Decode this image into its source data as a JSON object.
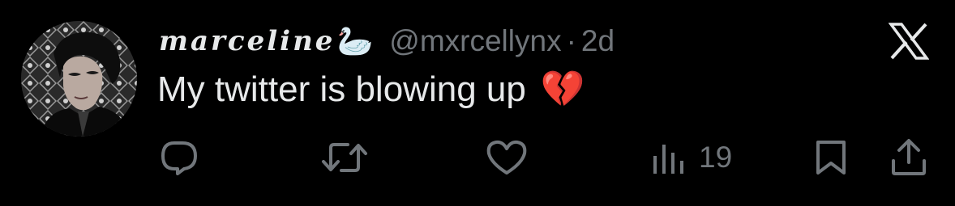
{
  "tweet": {
    "display_name": "marceline",
    "name_emoji": "🦢",
    "handle": "@mxrcellynx",
    "separator": "·",
    "time": "2d",
    "text": "My twitter is blowing up",
    "text_emoji": "💔"
  },
  "actions": {
    "reply_icon": "reply-icon",
    "retweet_icon": "retweet-icon",
    "like_icon": "like-icon",
    "views_icon": "views-icon",
    "views_count": "19",
    "bookmark_icon": "bookmark-icon",
    "share_icon": "share-icon"
  },
  "colors": {
    "background": "#000000",
    "text_primary": "#e7e9ea",
    "text_secondary": "#71767b"
  }
}
